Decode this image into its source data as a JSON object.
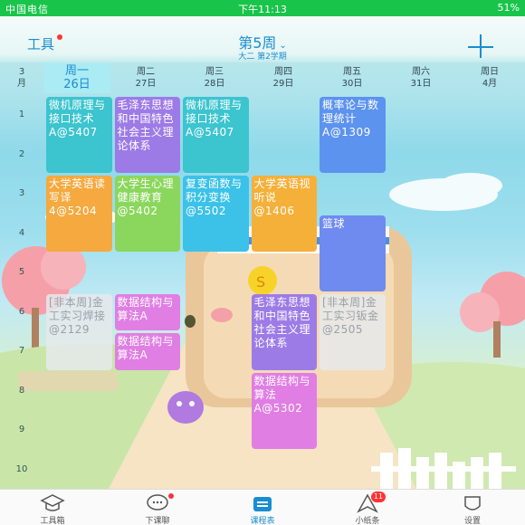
{
  "status_bar": {
    "carrier": "中国电信",
    "time": "下午11:13",
    "battery": "51%"
  },
  "header": {
    "tools_label": "工具",
    "week_label": "第5周",
    "week_chevron": "chevron-down-icon",
    "term_label": "大二 第2学期",
    "add_icon": "plus-icon"
  },
  "month": {
    "num": "3",
    "unit": "月"
  },
  "days": [
    {
      "weekday": "周一",
      "date": "26日",
      "today": true
    },
    {
      "weekday": "周二",
      "date": "27日",
      "today": false
    },
    {
      "weekday": "周三",
      "date": "28日",
      "today": false
    },
    {
      "weekday": "周四",
      "date": "29日",
      "today": false
    },
    {
      "weekday": "周五",
      "date": "30日",
      "today": false
    },
    {
      "weekday": "周六",
      "date": "31日",
      "today": false
    },
    {
      "weekday": "周日",
      "date": "4月",
      "today": false
    }
  ],
  "periods": [
    "1",
    "2",
    "3",
    "4",
    "5",
    "6",
    "7",
    "8",
    "9",
    "10"
  ],
  "courses": [
    {
      "day": 1,
      "start": 1,
      "end": 2,
      "text": "微机原理与接口技术A@5407",
      "color": "#3cc4cf"
    },
    {
      "day": 2,
      "start": 1,
      "end": 2,
      "text": "毛泽东思想和中国特色社会主义理论体系",
      "color": "#9d7be6"
    },
    {
      "day": 3,
      "start": 1,
      "end": 2,
      "text": "微机原理与接口技术A@5407",
      "color": "#3cc4cf"
    },
    {
      "day": 5,
      "start": 1,
      "end": 2,
      "text": "概率论与数理统计A@1309",
      "color": "#5c93ef"
    },
    {
      "day": 1,
      "start": 3,
      "end": 4,
      "text": "大学英语读写译4@5204",
      "color": "#f5a93f"
    },
    {
      "day": 2,
      "start": 3,
      "end": 4,
      "text": "大学生心理健康教育@5402",
      "color": "#8bd65d"
    },
    {
      "day": 3,
      "start": 3,
      "end": 4,
      "text": "复变函数与积分变换@5502",
      "color": "#3cc2e8"
    },
    {
      "day": 4,
      "start": 3,
      "end": 4,
      "text": "大学英语视听说@1406",
      "color": "#f5b03a"
    },
    {
      "day": 5,
      "start": 4,
      "end": 5,
      "text": "篮球",
      "color": "#6f8bf0"
    },
    {
      "day": 1,
      "start": 6,
      "end": 7,
      "text": "[非本周]金工实习焊接@2129",
      "color": "#d3d6d9"
    },
    {
      "day": 2,
      "start": 6,
      "end": 6,
      "text": "数据结构与算法A",
      "color": "#e07ee3"
    },
    {
      "day": 2,
      "start": 7,
      "end": 7,
      "text": "数据结构与算法A",
      "color": "#e07ee3"
    },
    {
      "day": 4,
      "start": 6,
      "end": 7,
      "text": "毛泽东思想和中国特色社会主义理论体系",
      "color": "#9d7be6"
    },
    {
      "day": 5,
      "start": 6,
      "end": 7,
      "text": "[非本周]金工实习钣金@2505",
      "color": "#d3d6d9"
    },
    {
      "day": 4,
      "start": 8,
      "end": 9,
      "text": "数据结构与算法A@5302",
      "color": "#e07ee3"
    }
  ],
  "nav": [
    {
      "label": "工具箱",
      "icon": "graduation-cap-icon",
      "active": false,
      "badge": ""
    },
    {
      "label": "下课聊",
      "icon": "chat-bubble-icon",
      "active": false,
      "badge": "dot"
    },
    {
      "label": "课程表",
      "icon": "schedule-icon",
      "active": true,
      "badge": ""
    },
    {
      "label": "小纸条",
      "icon": "paper-plane-icon",
      "active": false,
      "badge": "11"
    },
    {
      "label": "设置",
      "icon": "settings-icon",
      "active": false,
      "badge": ""
    }
  ]
}
